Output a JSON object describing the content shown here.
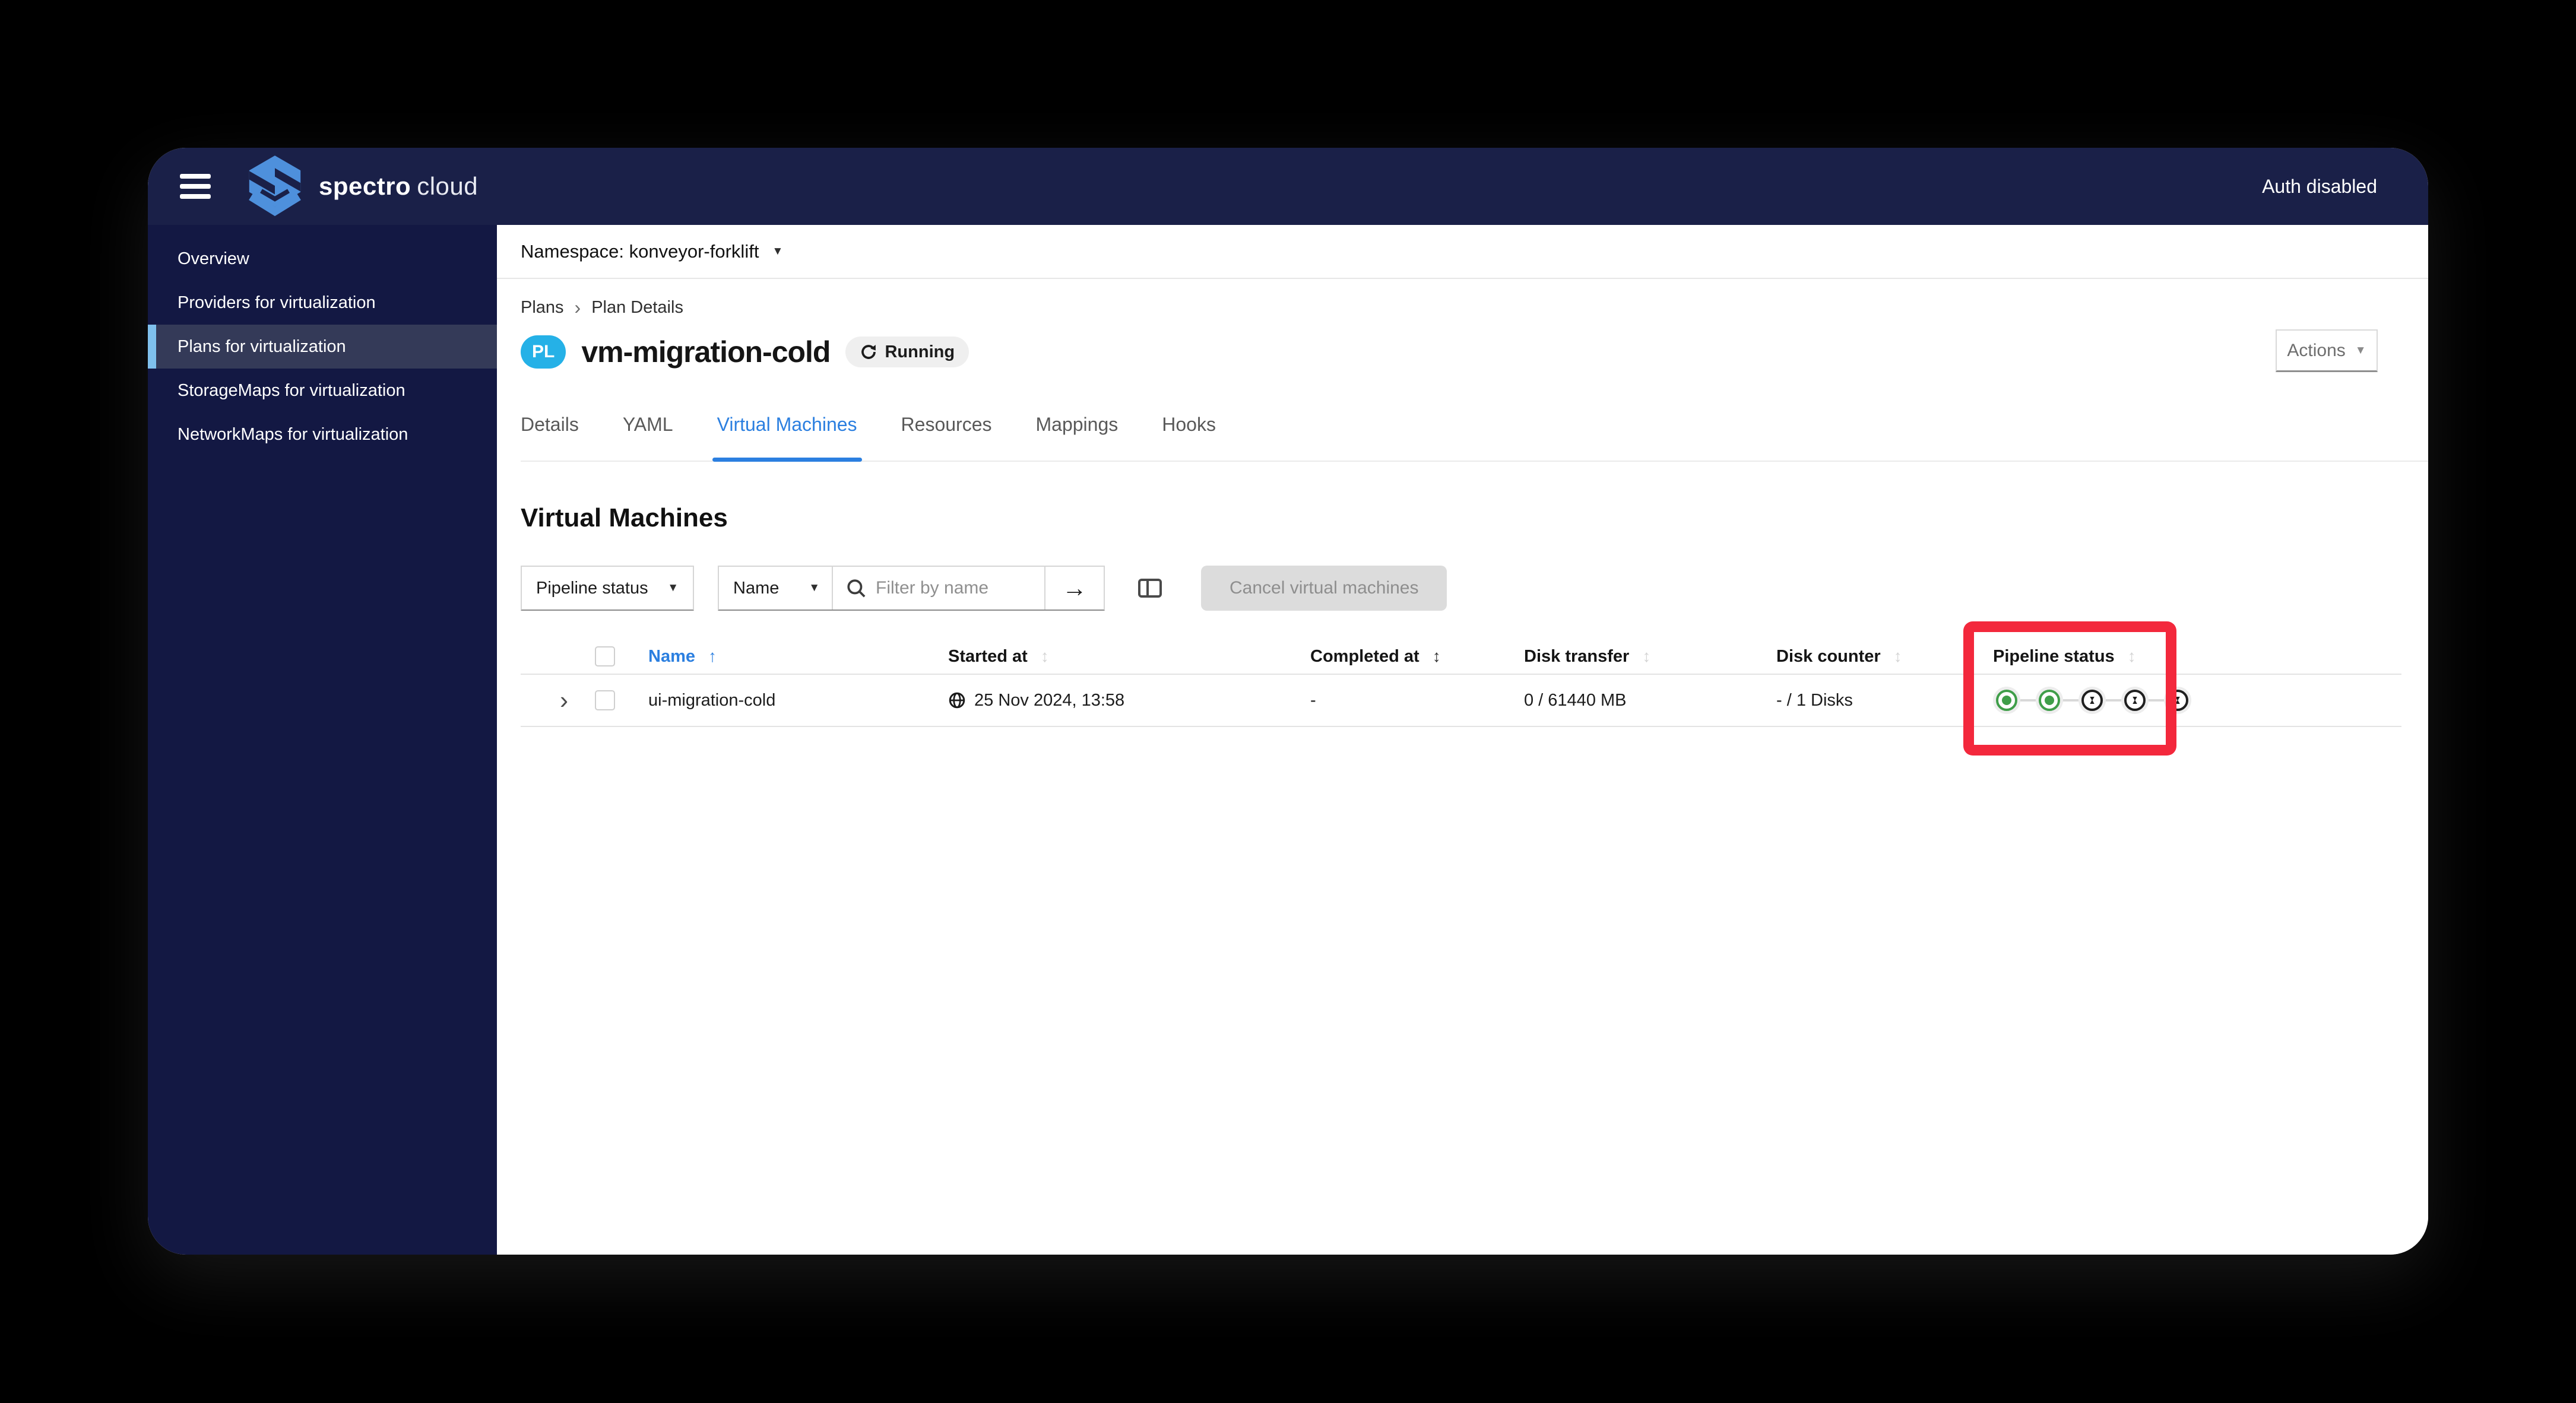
{
  "topbar": {
    "brand_primary": "spectro",
    "brand_secondary": "cloud",
    "auth_label": "Auth disabled"
  },
  "sidebar": {
    "items": [
      {
        "label": "Overview",
        "state": "normal"
      },
      {
        "label": "Providers for virtualization",
        "state": "normal"
      },
      {
        "label": "Plans for virtualization",
        "state": "selected"
      },
      {
        "label": "StorageMaps for virtualization",
        "state": "normal"
      },
      {
        "label": "NetworkMaps for virtualization",
        "state": "normal"
      }
    ]
  },
  "namespace_bar": {
    "label": "Namespace: konveyor-forklift"
  },
  "breadcrumb": {
    "parent": "Plans",
    "separator": "›",
    "current": "Plan Details"
  },
  "plan_header": {
    "badge": "PL",
    "title": "vm-migration-cold",
    "status_label": "Running",
    "actions_label": "Actions"
  },
  "tabs": [
    {
      "label": "Details",
      "state": "normal"
    },
    {
      "label": "YAML",
      "state": "normal"
    },
    {
      "label": "Virtual Machines",
      "state": "active"
    },
    {
      "label": "Resources",
      "state": "normal"
    },
    {
      "label": "Mappings",
      "state": "normal"
    },
    {
      "label": "Hooks",
      "state": "normal"
    }
  ],
  "section": {
    "heading": "Virtual Machines"
  },
  "filters": {
    "pipeline_status_label": "Pipeline status",
    "attribute_label": "Name",
    "search_placeholder": "Filter by name",
    "cancel_button_label": "Cancel virtual machines"
  },
  "table": {
    "headers": {
      "name": "Name",
      "started": "Started at",
      "completed": "Completed at",
      "disk_transfer": "Disk transfer",
      "disk_counter": "Disk counter",
      "pipeline": "Pipeline status"
    },
    "rows": [
      {
        "name": "ui-migration-cold",
        "started": "25 Nov 2024, 13:58",
        "completed": "-",
        "disk_transfer": "0 / 61440 MB",
        "disk_counter": "- / 1 Disks",
        "pipeline_steps": [
          {
            "state": "completed"
          },
          {
            "state": "completed"
          },
          {
            "state": "pending"
          },
          {
            "state": "pending"
          },
          {
            "state": "pending"
          }
        ]
      }
    ]
  },
  "icons": {
    "caret_down": "▼",
    "sort_asc": "↑",
    "sort_both": "↕",
    "arrow_right": "→",
    "row_expand": "›"
  },
  "colors": {
    "navy_topbar": "#1a2048",
    "navy_sidebar": "#131843",
    "selected_item_bg": "#343a58",
    "selected_item_bar": "#7fc0ec",
    "accent_blue": "#2b7fe0",
    "badge_cyan": "#25b1e7",
    "pipeline_green": "#3f9e49",
    "pipeline_pending": "#1f1f1f",
    "highlight_red": "#f3283c"
  }
}
